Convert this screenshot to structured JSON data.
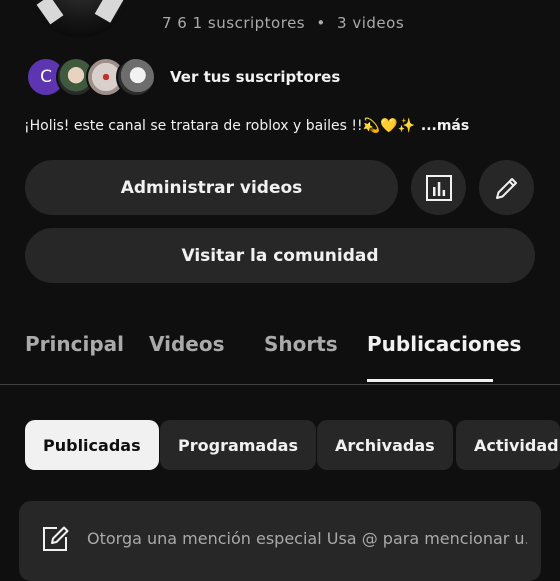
{
  "channel": {
    "stats": {
      "subscribers": "7 6 1 suscriptores",
      "separator": "•",
      "videos": "3 videos"
    },
    "subscribers_link": "Ver tus suscriptores",
    "subscriber_avatar_initial": "C",
    "description": "¡Holis!  este canal se tratara de roblox y bailes !!💫💛✨",
    "more_label": "...más"
  },
  "actions": {
    "manage_videos": "Administrar videos",
    "stats_icon": "analytics-icon",
    "edit_icon": "pencil-icon",
    "visit_community": "Visitar la comunidad"
  },
  "tabs": [
    {
      "label": "Principal",
      "active": false
    },
    {
      "label": "Videos",
      "active": false
    },
    {
      "label": "Shorts",
      "active": false
    },
    {
      "label": "Publicaciones",
      "active": true
    }
  ],
  "filters": [
    {
      "label": "Publicadas",
      "active": true
    },
    {
      "label": "Programadas",
      "active": false
    },
    {
      "label": "Archivadas",
      "active": false
    },
    {
      "label": "Actividad de",
      "active": false
    }
  ],
  "composer": {
    "icon": "compose-icon",
    "placeholder": "Otorga una mención especial Usa @ para mencionar u..."
  },
  "colors": {
    "background": "#0f0f0f",
    "surface": "#272727",
    "text": "#f1f1f1",
    "muted": "#aaaaaa"
  }
}
